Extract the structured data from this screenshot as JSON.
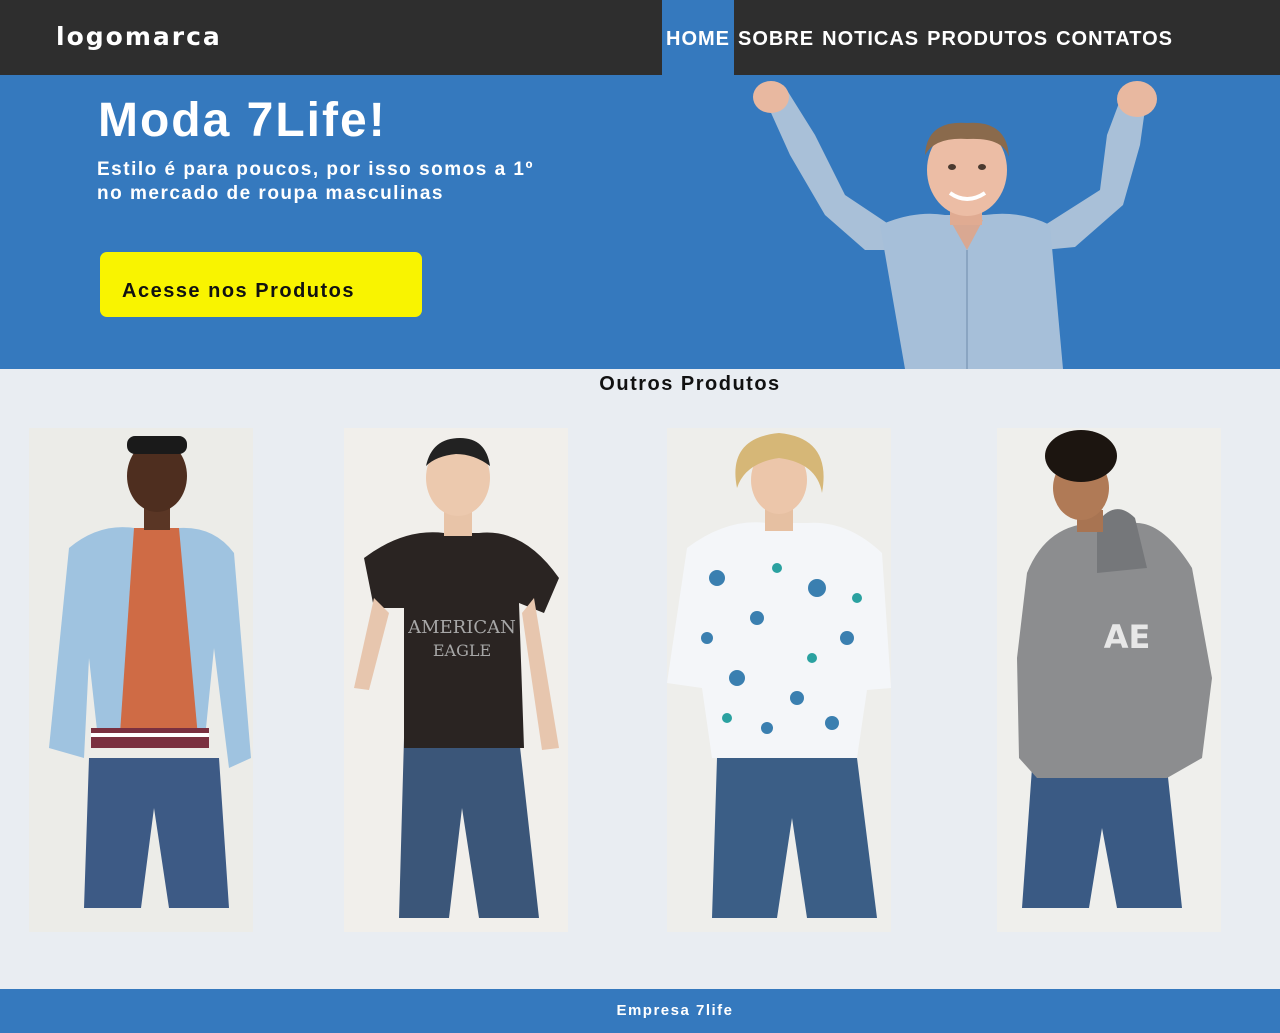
{
  "header": {
    "logo": "logomarca",
    "nav": [
      {
        "label": "HOME",
        "active": true
      },
      {
        "label": "SOBRE",
        "active": false
      },
      {
        "label": "NOTICAS",
        "active": false
      },
      {
        "label": "PRODUTOS",
        "active": false
      },
      {
        "label": "CONTATOS",
        "active": false
      }
    ]
  },
  "hero": {
    "title": "Moda 7Life!",
    "subtitle": "Estilo é para poucos, por isso somos a 1º no mercado de roupa masculinas",
    "cta_label": "Acesse nos Produtos",
    "image": "man-cheering-photo"
  },
  "products": {
    "title": "Outros Produtos",
    "items": [
      {
        "image": "model-bomber-jacket-photo"
      },
      {
        "image": "model-black-tee-photo"
      },
      {
        "image": "model-floral-shirt-photo"
      },
      {
        "image": "model-grey-hoodie-photo"
      }
    ]
  },
  "footer": {
    "text": "Empresa 7life"
  },
  "colors": {
    "header_bg": "#2e2e2e",
    "brand_blue": "#3579be",
    "cta_yellow": "#f9f400",
    "page_bg": "#e9edf2"
  }
}
